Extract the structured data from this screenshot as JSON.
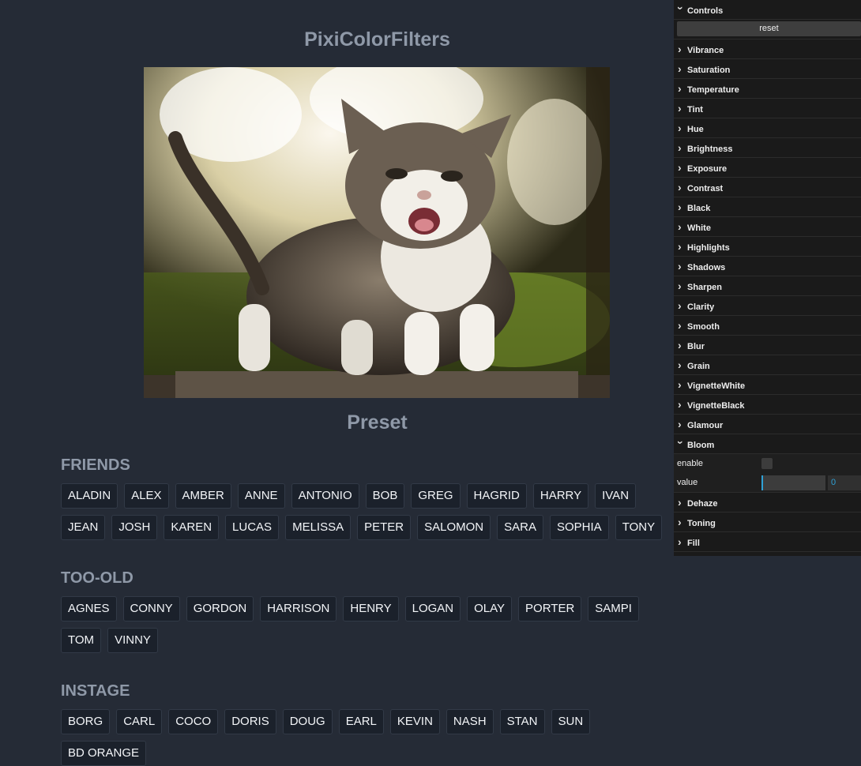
{
  "page": {
    "title": "PixiColorFilters",
    "preset_title": "Preset"
  },
  "groups": [
    {
      "title": "FRIENDS",
      "buttons": [
        "ALADIN",
        "ALEX",
        "AMBER",
        "ANNE",
        "ANTONIO",
        "BOB",
        "GREG",
        "HAGRID",
        "HARRY",
        "IVAN",
        "JEAN",
        "JOSH",
        "KAREN",
        "LUCAS",
        "MELISSA",
        "PETER",
        "SALOMON",
        "SARA",
        "SOPHIA",
        "TONY"
      ]
    },
    {
      "title": "TOO-OLD",
      "buttons": [
        "AGNES",
        "CONNY",
        "GORDON",
        "HARRISON",
        "HENRY",
        "LOGAN",
        "OLAY",
        "PORTER",
        "SAMPI",
        "TOM",
        "VINNY"
      ]
    },
    {
      "title": "INSTAGE",
      "buttons": [
        "BORG",
        "CARL",
        "COCO",
        "DORIS",
        "DOUG",
        "EARL",
        "KEVIN",
        "NASH",
        "STAN",
        "SUN",
        "BD ORANGE"
      ]
    }
  ],
  "panel": {
    "title": "Controls",
    "reset_label": "reset",
    "folders_before": [
      "Vibrance",
      "Saturation",
      "Temperature",
      "Tint",
      "Hue",
      "Brightness",
      "Exposure",
      "Contrast",
      "Black",
      "White",
      "Highlights",
      "Shadows",
      "Sharpen",
      "Clarity",
      "Smooth",
      "Blur",
      "Grain",
      "VignetteWhite",
      "VignetteBlack",
      "Glamour"
    ],
    "open_folder": {
      "label": "Bloom",
      "enable_label": "enable",
      "enable_checked": false,
      "value_label": "value",
      "value": "0"
    },
    "folders_after": [
      "Dehaze",
      "Toning",
      "Fill"
    ]
  },
  "colors": {
    "accent": "#2fa1d6",
    "background": "#252b36",
    "heading": "#8f99a8"
  }
}
